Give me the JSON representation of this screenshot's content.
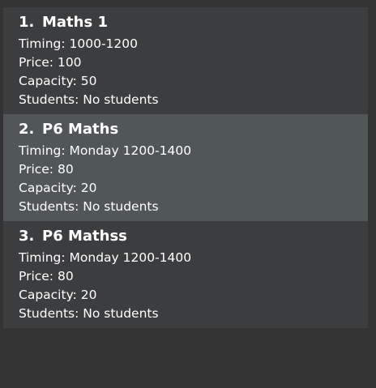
{
  "classes": [
    {
      "index": "1.",
      "name": "Maths 1",
      "timing": "Timing: 1000-1200",
      "price": "Price: 100",
      "capacity": "Capacity: 50",
      "students": "Students: No students",
      "selected": false
    },
    {
      "index": "2.",
      "name": "P6 Maths",
      "timing": "Timing: Monday 1200-1400",
      "price": "Price: 80",
      "capacity": "Capacity: 20",
      "students": "Students: No students",
      "selected": true
    },
    {
      "index": "3.",
      "name": "P6 Mathss",
      "timing": "Timing: Monday 1200-1400",
      "price": "Price: 80",
      "capacity": "Capacity: 20",
      "students": "Students: No students",
      "selected": false
    }
  ],
  "colors": {
    "background": "#333333",
    "card": "#3c3d3f",
    "card_selected": "#515659",
    "text": "#ffffff"
  }
}
